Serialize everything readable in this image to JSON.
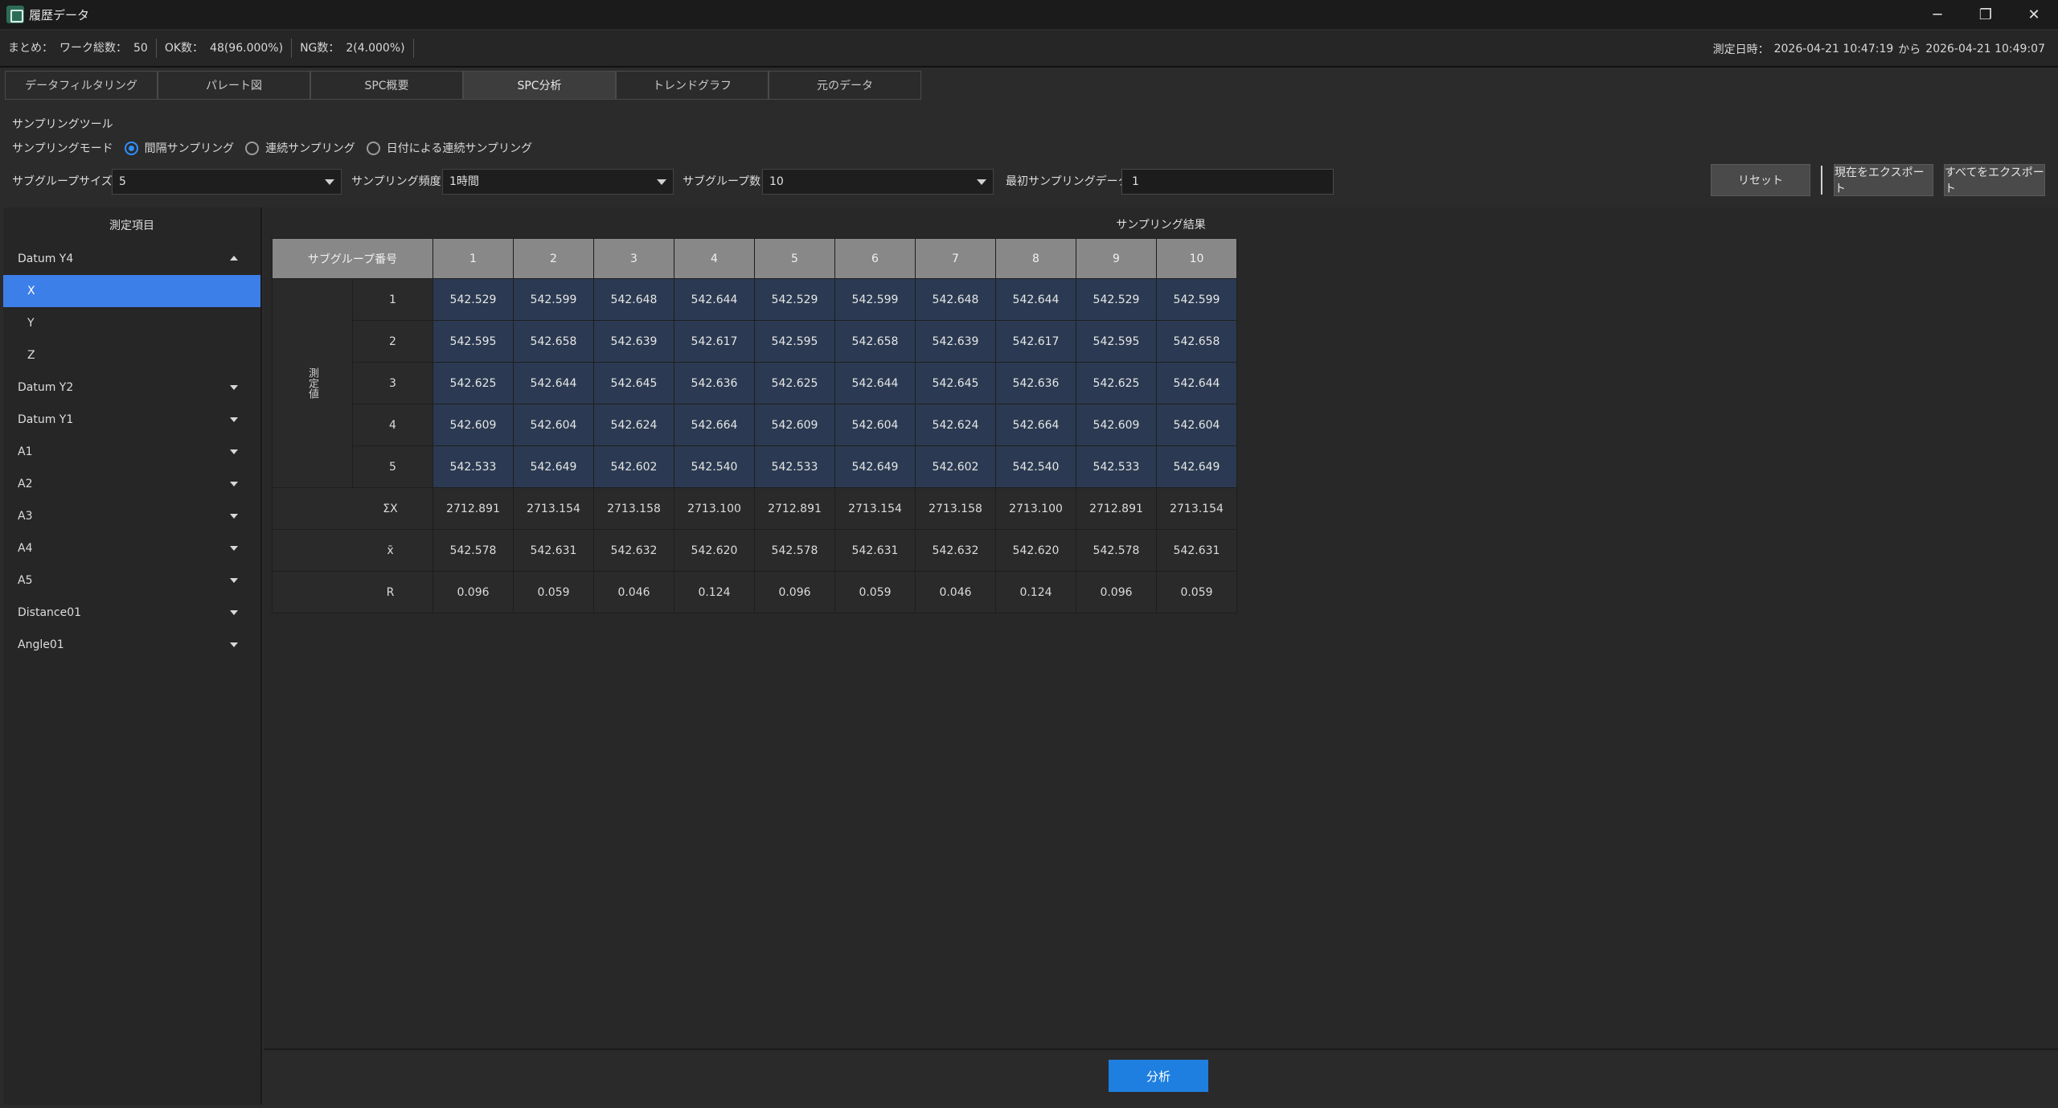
{
  "window": {
    "title": "履歴データ",
    "controls": [
      "─",
      "❐",
      "✕"
    ]
  },
  "summary": {
    "label": "まとめ：",
    "total_label": "ワーク総数：",
    "total_value": "50",
    "ok_label": "OK数：",
    "ok_value": "48(96.000%)",
    "ng_label": "NG数：",
    "ng_value": "2(4.000%)",
    "date_label": "測定日時：",
    "date_from": "2026-04-21 10:47:19",
    "date_sep": "から",
    "date_to": "2026-04-21 10:49:07"
  },
  "tabs": [
    {
      "label": "データフィルタリング",
      "active": false
    },
    {
      "label": "パレート図",
      "active": false
    },
    {
      "label": "SPC概要",
      "active": false
    },
    {
      "label": "SPC分析",
      "active": true
    },
    {
      "label": "トレンドグラフ",
      "active": false
    },
    {
      "label": "元のデータ",
      "active": false
    }
  ],
  "tool": {
    "title": "サンプリングツール",
    "mode_label": "サンプリングモード",
    "modes": [
      {
        "label": "間隔サンプリング",
        "selected": true
      },
      {
        "label": "連続サンプリング",
        "selected": false
      },
      {
        "label": "日付による連続サンプリング",
        "selected": false
      }
    ],
    "subgroup_size_label": "サブグループサイズ",
    "subgroup_size_value": "5",
    "frequency_label": "サンプリング頻度",
    "frequency_value": "1時間",
    "subgroup_count_label": "サブグループ数",
    "subgroup_count_value": "10",
    "first_data_label": "最初サンプリングデータ",
    "first_data_value": "1",
    "reset_label": "リセット",
    "export_current_label": "現在をエクスポート",
    "export_all_label": "すべてをエクスポート"
  },
  "measure_panel": {
    "header": "測定項目",
    "items": [
      {
        "label": "Datum Y4",
        "type": "group",
        "expanded": true
      },
      {
        "label": "X",
        "type": "child",
        "selected": true
      },
      {
        "label": "Y",
        "type": "child",
        "selected": false
      },
      {
        "label": "Z",
        "type": "child",
        "selected": false
      },
      {
        "label": "Datum Y2",
        "type": "group",
        "expanded": false
      },
      {
        "label": "Datum Y1",
        "type": "group",
        "expanded": false
      },
      {
        "label": "A1",
        "type": "group",
        "expanded": false
      },
      {
        "label": "A2",
        "type": "group",
        "expanded": false
      },
      {
        "label": "A3",
        "type": "group",
        "expanded": false
      },
      {
        "label": "A4",
        "type": "group",
        "expanded": false
      },
      {
        "label": "A5",
        "type": "group",
        "expanded": false
      },
      {
        "label": "Distance01",
        "type": "group",
        "expanded": false
      },
      {
        "label": "Angle01",
        "type": "group",
        "expanded": false
      }
    ]
  },
  "results": {
    "title": "サンプリング結果",
    "corner_header": "サブグループ番号",
    "vertical_label": "測定値",
    "columns": [
      "1",
      "2",
      "3",
      "4",
      "5",
      "6",
      "7",
      "8",
      "9",
      "10"
    ],
    "rows": [
      {
        "num": "1",
        "values": [
          "542.529",
          "542.599",
          "542.648",
          "542.644",
          "542.529",
          "542.599",
          "542.648",
          "542.644",
          "542.529",
          "542.599"
        ]
      },
      {
        "num": "2",
        "values": [
          "542.595",
          "542.658",
          "542.639",
          "542.617",
          "542.595",
          "542.658",
          "542.639",
          "542.617",
          "542.595",
          "542.658"
        ]
      },
      {
        "num": "3",
        "values": [
          "542.625",
          "542.644",
          "542.645",
          "542.636",
          "542.625",
          "542.644",
          "542.645",
          "542.636",
          "542.625",
          "542.644"
        ]
      },
      {
        "num": "4",
        "values": [
          "542.609",
          "542.604",
          "542.624",
          "542.664",
          "542.609",
          "542.604",
          "542.624",
          "542.664",
          "542.609",
          "542.604"
        ]
      },
      {
        "num": "5",
        "values": [
          "542.533",
          "542.649",
          "542.602",
          "542.540",
          "542.533",
          "542.649",
          "542.602",
          "542.540",
          "542.533",
          "542.649"
        ]
      }
    ],
    "stats": [
      {
        "label": "ΣX",
        "values": [
          "2712.891",
          "2713.154",
          "2713.158",
          "2713.100",
          "2712.891",
          "2713.154",
          "2713.158",
          "2713.100",
          "2712.891",
          "2713.154"
        ]
      },
      {
        "label": "x̄",
        "values": [
          "542.578",
          "542.631",
          "542.632",
          "542.620",
          "542.578",
          "542.631",
          "542.632",
          "542.620",
          "542.578",
          "542.631"
        ]
      },
      {
        "label": "R",
        "values": [
          "0.096",
          "0.059",
          "0.046",
          "0.124",
          "0.096",
          "0.059",
          "0.046",
          "0.124",
          "0.096",
          "0.059"
        ]
      }
    ]
  },
  "analyze_label": "分析"
}
